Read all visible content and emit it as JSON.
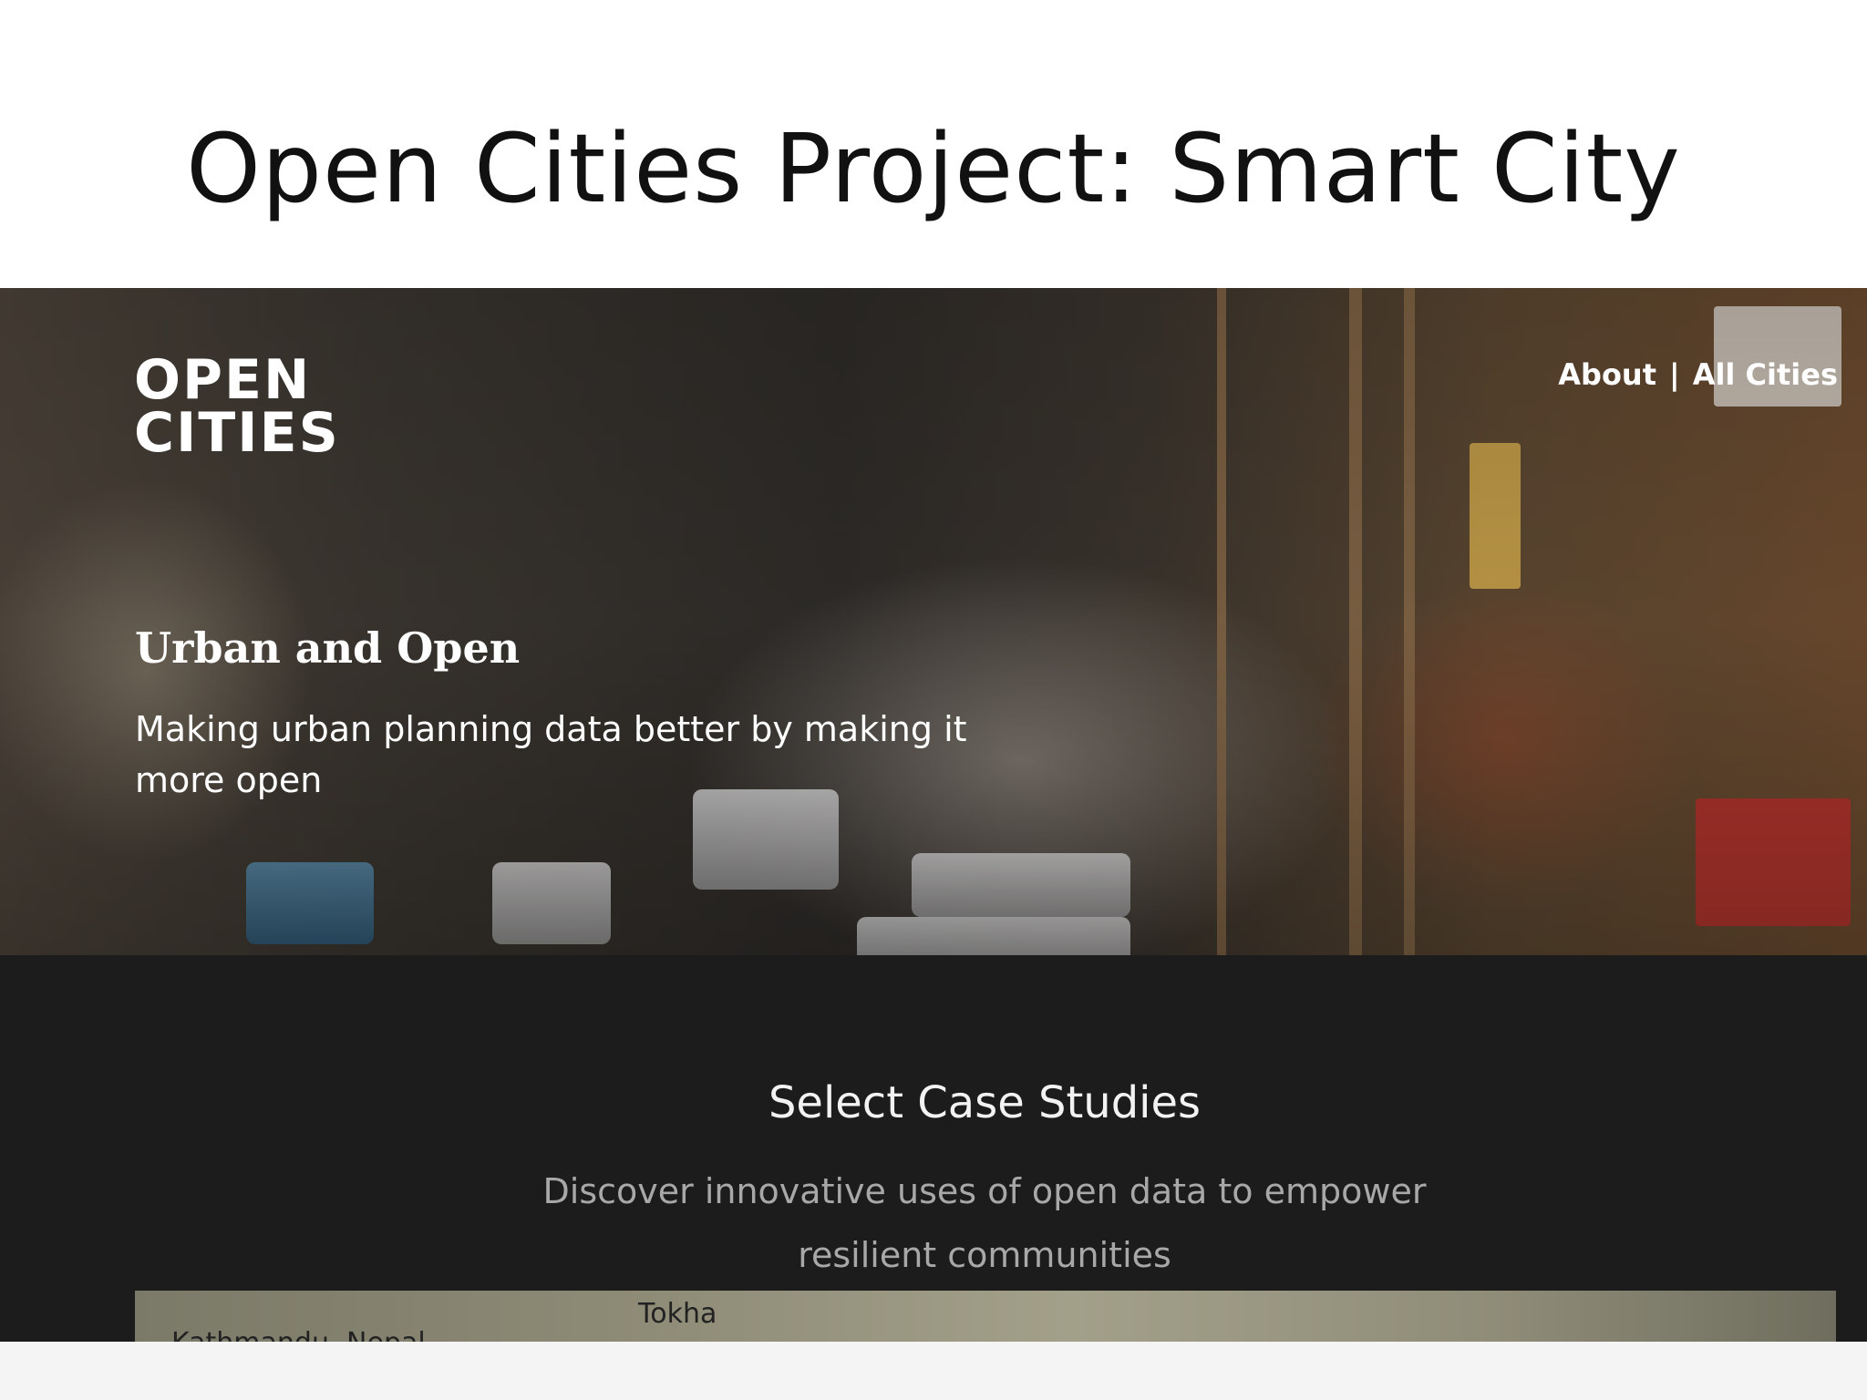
{
  "slide": {
    "title": "Open Cities Project: Smart City"
  },
  "site": {
    "logo": {
      "line1": "OPEN",
      "line2": "CITIES"
    },
    "nav": {
      "about": "About",
      "separator": "|",
      "all_cities": "All Cities"
    },
    "hero": {
      "heading": "Urban and Open",
      "subheading": "Making urban planning data better by making it more open"
    },
    "case_studies": {
      "title": "Select Case Studies",
      "subtitle": "Discover innovative uses of open data to empower resilient communities"
    },
    "map": {
      "labels": [
        "Kathmandu, Nepal",
        "Tokha"
      ]
    }
  },
  "colors": {
    "slide_background": "#ffffff",
    "dark_section": "#1c1c1c",
    "hero_text": "#ffffff",
    "subtitle_text": "#a8a8a8"
  }
}
